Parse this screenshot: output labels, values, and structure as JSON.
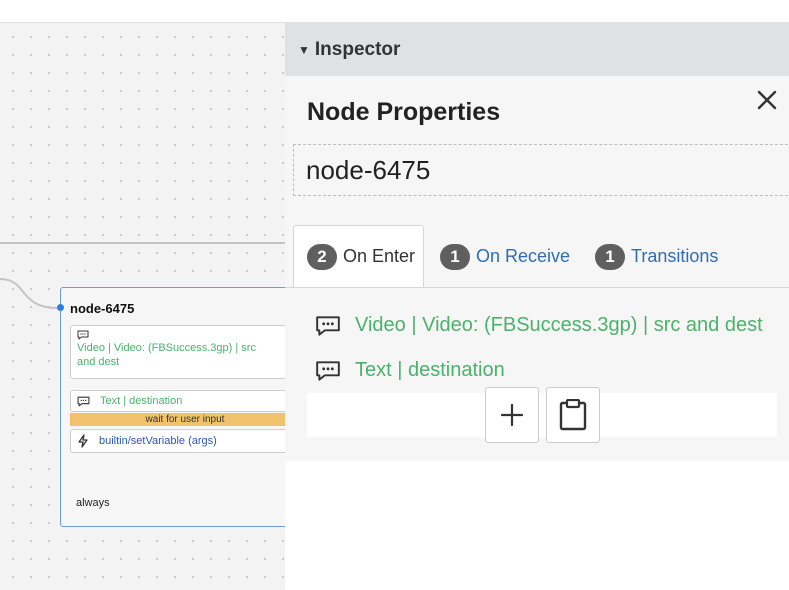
{
  "inspector": {
    "header": "Inspector",
    "title": "Node Properties",
    "node_name": "node-6475",
    "tabs": [
      {
        "count": "2",
        "label": "On Enter",
        "active": true
      },
      {
        "count": "1",
        "label": "On Receive",
        "active": false
      },
      {
        "count": "1",
        "label": "Transitions",
        "active": false
      }
    ],
    "actions": [
      {
        "icon": "speech-bubble-icon",
        "label": "Video | Video: (FBSuccess.3gp) | src and dest"
      },
      {
        "icon": "speech-bubble-icon",
        "label": "Text | destination"
      }
    ],
    "add_icon": "plus-icon",
    "paste_icon": "clipboard-icon"
  },
  "node": {
    "title": "node-6475",
    "items": [
      {
        "icon": "speech-bubble-icon",
        "label": "Video | Video: (FBSuccess.3gp) | src and dest"
      },
      {
        "icon": "speech-bubble-icon",
        "label": "Text | destination"
      }
    ],
    "wait_label": "wait for user input",
    "action": {
      "icon": "lightning-icon",
      "label": "builtin/setVariable (args)"
    },
    "transition": "always"
  },
  "colors": {
    "accent_green": "#4bb26c",
    "link_blue": "#2f6db5",
    "node_border": "#6d9be0",
    "wait_bar": "#f2c16b"
  }
}
